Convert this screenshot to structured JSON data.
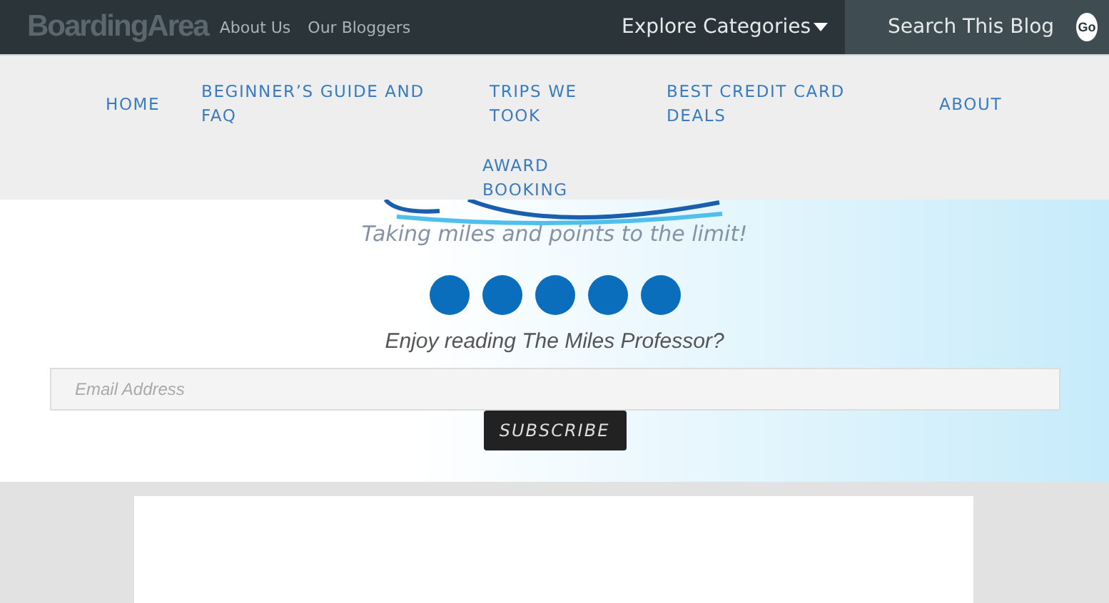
{
  "top_bar": {
    "logo": "BoardingArea",
    "links": [
      "About Us",
      "Our Bloggers"
    ],
    "categories": "Explore Categories",
    "search": {
      "placeholder": "Search This Blog"
    },
    "go_button": "Go"
  },
  "nav": {
    "items": [
      "HOME",
      "BEGINNER’S GUIDE AND FAQ",
      "TRIPS WE TOOK",
      "BEST CREDIT CARD DEALS",
      "ABOUT",
      "AWARD BOOKING"
    ]
  },
  "hero": {
    "tagline": "Taking miles and points to the limit!",
    "prompt": "Enjoy reading The Miles Professor?",
    "email": {
      "placeholder": "Email Address"
    },
    "subscribe": "SUBSCRIBE"
  }
}
